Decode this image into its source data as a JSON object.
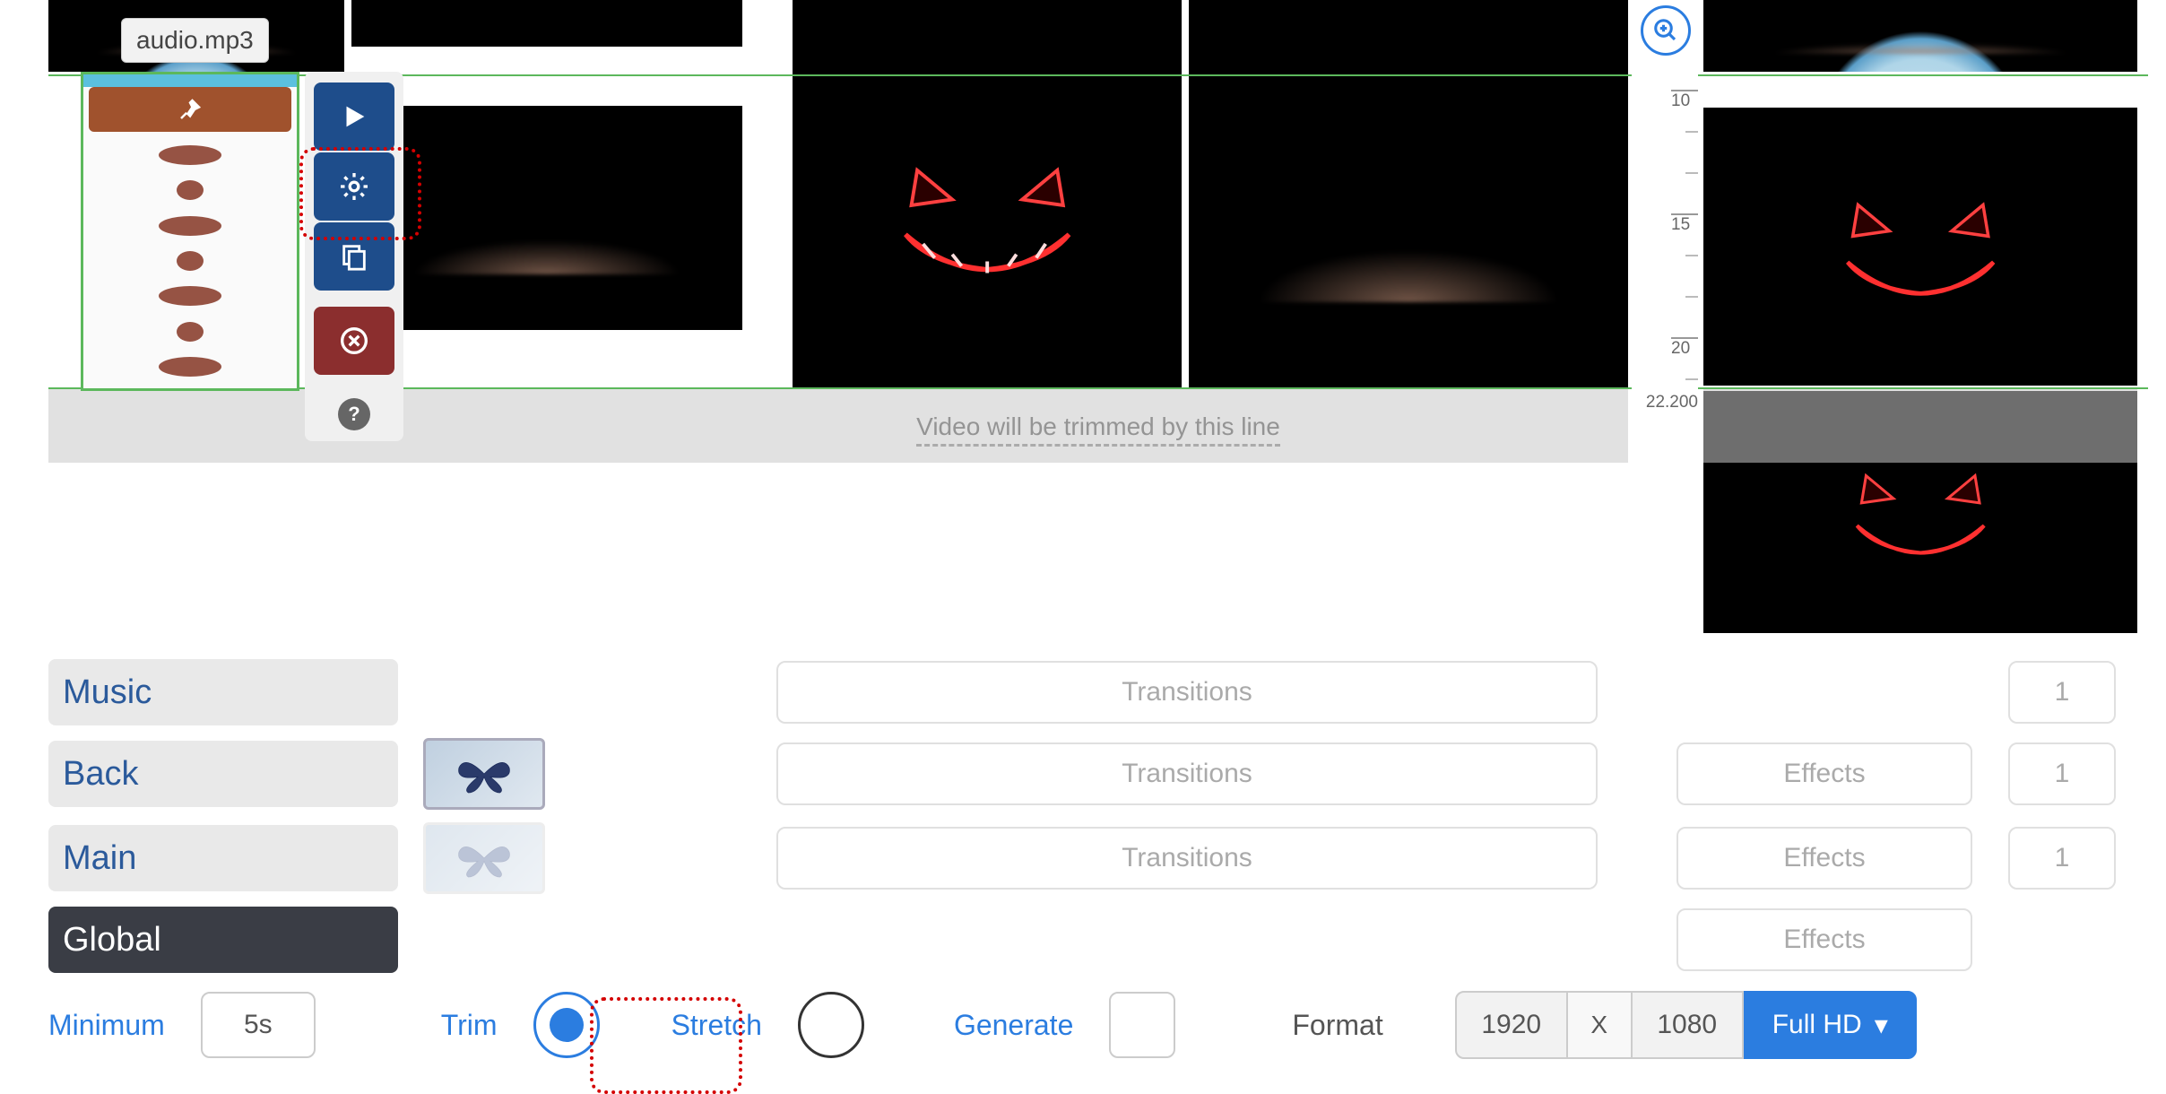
{
  "audio": {
    "filename": "audio.mp3"
  },
  "ruler": {
    "ticks": [
      "10",
      "15",
      "20"
    ],
    "end": "22.200"
  },
  "trim_message": "Video will be trimmed by this line",
  "layers": {
    "music": {
      "label": "Music",
      "transitions": "Transitions",
      "count": "1"
    },
    "back": {
      "label": "Back",
      "transitions": "Transitions",
      "effects": "Effects",
      "count": "1"
    },
    "main": {
      "label": "Main",
      "transitions": "Transitions",
      "effects": "Effects",
      "count": "1"
    },
    "global": {
      "label": "Global",
      "effects": "Effects"
    }
  },
  "bottom": {
    "minimum_label": "Minimum",
    "minimum_value": "5s",
    "trim_label": "Trim",
    "stretch_label": "Stretch",
    "generate_label": "Generate",
    "format_label": "Format",
    "width": "1920",
    "x": "X",
    "height": "1080",
    "preset": "Full HD"
  },
  "icons": {
    "pin": "pin",
    "play": "play",
    "gear": "gear",
    "copy": "copy",
    "delete": "delete",
    "help": "?",
    "zoom_in": "zoom-in",
    "caret_down": "▾"
  }
}
